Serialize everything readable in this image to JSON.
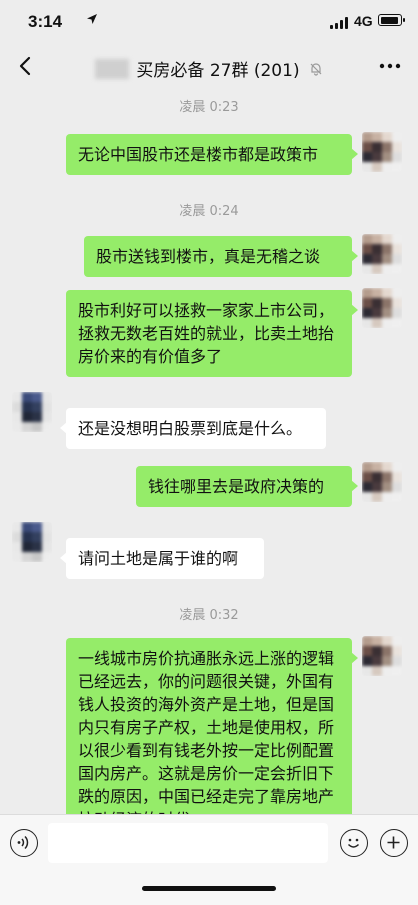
{
  "status": {
    "time": "3:14",
    "network": "4G"
  },
  "nav": {
    "title": "买房必备 27群 (201)"
  },
  "messages": {
    "t1": "凌晨 0:23",
    "m1": "无论中国股市还是楼市都是政策市",
    "t2": "凌晨 0:24",
    "m2": "股市送钱到楼市，真是无稽之谈",
    "m3": "股市利好可以拯救一家家上市公司，拯救无数老百姓的就业，比卖土地抬房价来的有价值多了",
    "m4": "还是没想明白股票到底是什么。",
    "m5": "钱往哪里去是政府决策的",
    "m6": "请问土地是属于谁的啊",
    "t3": "凌晨 0:32",
    "m7": "一线城市房价抗通胀永远上涨的逻辑已经远去，你的问题很关键，外国有钱人投资的海外资产是土地，但是国内只有房子产权，土地是使用权，所以很少看到有钱老外按一定比例配置国内房产。这就是房价一定会折旧下跌的原因，中国已经走完了靠房地产拉动经济的时代"
  },
  "colors": {
    "bubble_me": "#95ec69",
    "bubble_them": "#ffffff",
    "background": "#ededed"
  }
}
